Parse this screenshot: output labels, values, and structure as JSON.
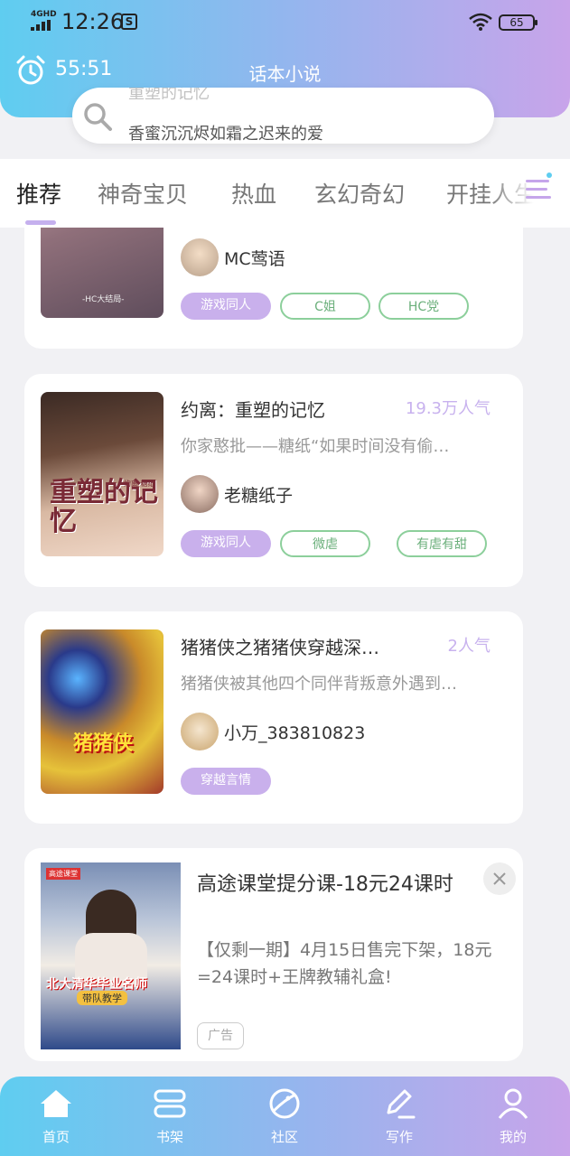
{
  "status_bar": {
    "network": "4GHD",
    "time": "12:26",
    "battery": "65"
  },
  "header": {
    "timer": "55:51",
    "title": "话本小说"
  },
  "search": {
    "ghost_text": "重塑的记忆",
    "placeholder": "香蜜沉沉烬如霜之迟来的爱"
  },
  "tabs": [
    {
      "label": "推荐",
      "active": true
    },
    {
      "label": "神奇宝贝"
    },
    {
      "label": "热血"
    },
    {
      "label": "玄幻奇幻"
    },
    {
      "label": "开挂人生"
    }
  ],
  "cards": [
    {
      "cover_text": "-HC大结局-",
      "author": "MC莺语",
      "tags": [
        "游戏同人",
        "C姐",
        "HC党"
      ]
    },
    {
      "title": "约离：重塑的记忆",
      "popularity": "19.3万人气",
      "desc": "你家憨批——糖纸“如果时间没有偷…",
      "cover_text": "重塑的记忆",
      "cover_small": "约离 糖纸",
      "author": "老糖纸子",
      "tags": [
        "游戏同人",
        "微虐",
        "有虐有甜"
      ]
    },
    {
      "title": "猪猪侠之猪猪侠穿越深…",
      "popularity": "2人气",
      "desc": "猪猪侠被其他四个同伴背叛意外遇到…",
      "cover_text": "猪猪侠",
      "author": "小万_383810823",
      "tags": [
        "穿越言情"
      ]
    }
  ],
  "ad": {
    "title": "高途课堂提分课-18元24课时",
    "desc": "【仅剩一期】4月15日售完下架，18元=24课时+王牌教辅礼盒!",
    "badge": "广告",
    "img_top": "高途课堂",
    "img_caption": "北大清华毕业名师",
    "img_sub": "带队教学"
  },
  "bottom_nav": [
    {
      "label": "首页",
      "icon": "home-icon",
      "active": true
    },
    {
      "label": "书架",
      "icon": "bookshelf-icon"
    },
    {
      "label": "社区",
      "icon": "planet-icon"
    },
    {
      "label": "写作",
      "icon": "pen-icon"
    },
    {
      "label": "我的",
      "icon": "user-icon"
    }
  ],
  "colors": {
    "gradient_start": "#5fcdf0",
    "gradient_end": "#c8a4ea",
    "accent_purple": "#c9b0ec",
    "tag_green": "#8ccf9b"
  }
}
